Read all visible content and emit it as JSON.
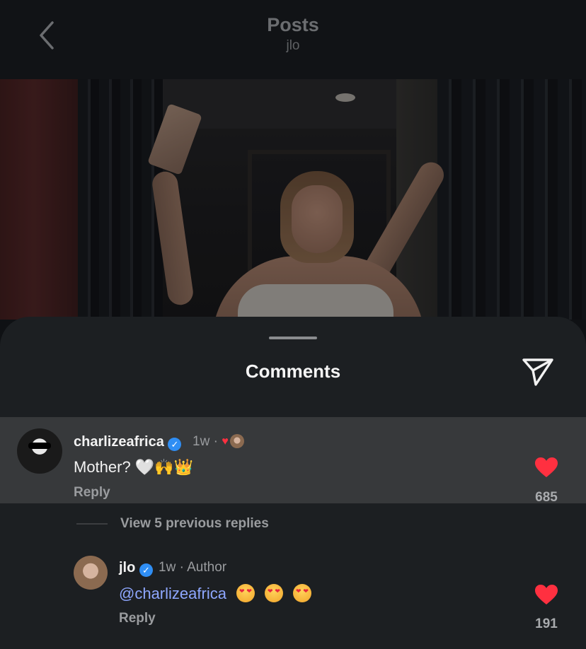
{
  "header": {
    "title": "Posts",
    "subtitle": "jlo"
  },
  "sheet": {
    "title": "Comments"
  },
  "comments": [
    {
      "username": "charlizeafrica",
      "time": "1w",
      "sep": "·",
      "text": "Mother? 🤍🙌👑",
      "reply_label": "Reply",
      "likes": "685"
    }
  ],
  "replies_toggle": {
    "label": "View 5 previous replies"
  },
  "reply": {
    "username": "jlo",
    "time": "1w",
    "author_tag": "· Author",
    "mention": "@charlizeafrica",
    "reply_label": "Reply",
    "likes": "191"
  },
  "colors": {
    "like": "#ff3040",
    "verified": "#2f8ef4",
    "mention": "#8ea7ff"
  }
}
